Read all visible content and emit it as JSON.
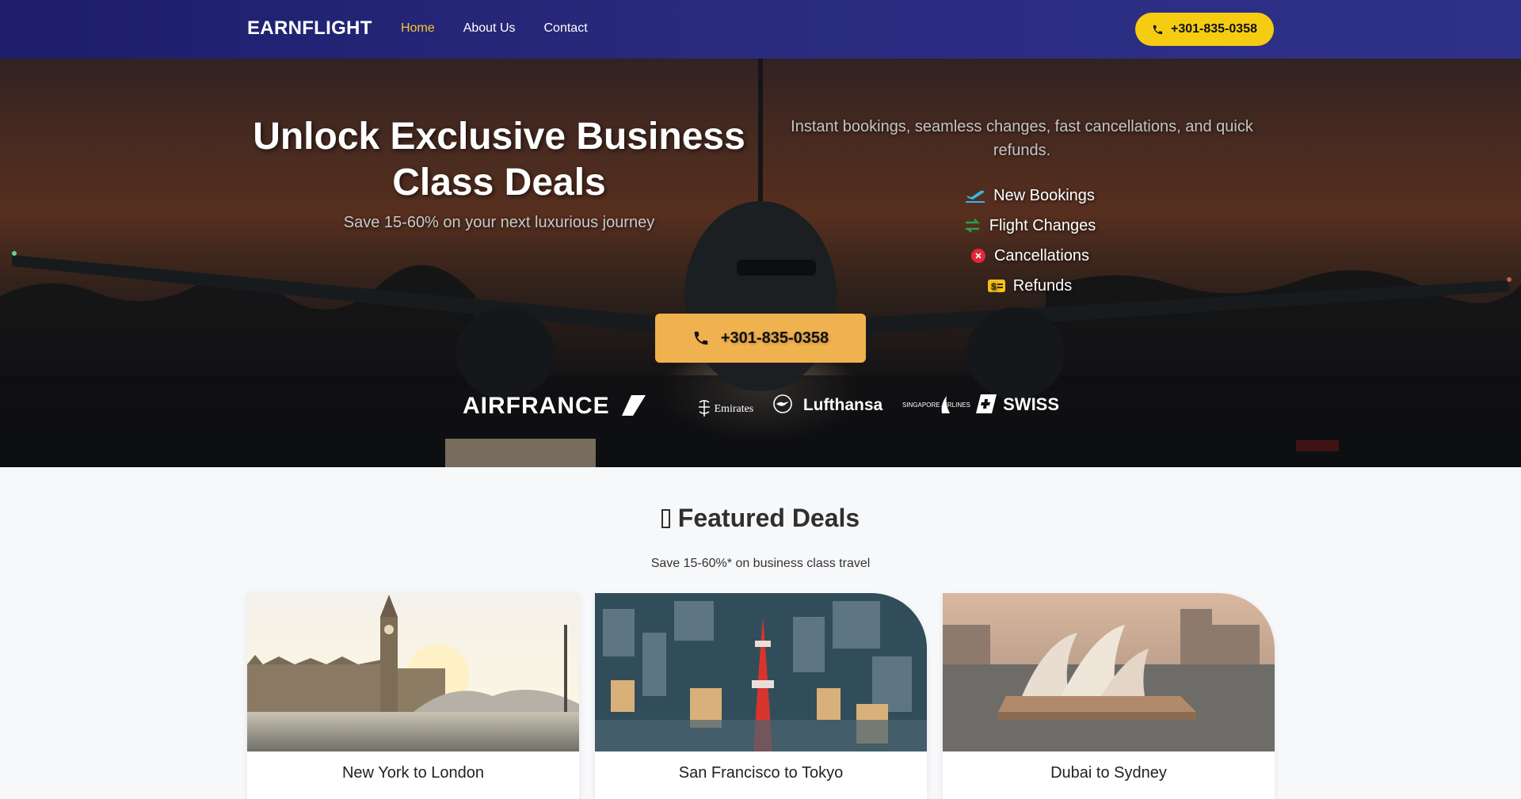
{
  "nav": {
    "brand": "EARNFLIGHT",
    "links": [
      {
        "label": "Home",
        "active": true
      },
      {
        "label": "About Us",
        "active": false
      },
      {
        "label": "Contact",
        "active": false
      }
    ],
    "phone": "+301-835-0358",
    "phone_icon": "phone-icon"
  },
  "hero": {
    "title": "Unlock Exclusive Business Class Deals",
    "subtitle": "Save 15-60% on your next luxurious journey",
    "tagline": "Instant bookings, seamless changes, fast cancellations, and quick refunds.",
    "features": [
      {
        "label": "New Bookings",
        "icon": "plane-departure-icon",
        "color": "#37b6e8"
      },
      {
        "label": "Flight Changes",
        "icon": "exchange-arrows-icon",
        "color": "#2e9e4a"
      },
      {
        "label": "Cancellations",
        "icon": "cancel-circle-icon",
        "color": "#e2263a"
      },
      {
        "label": "Refunds",
        "icon": "money-bill-icon",
        "color": "#f6c21c"
      }
    ],
    "call_phone": "+301-835-0358",
    "airlines": [
      "AIRFRANCE",
      "Emirates",
      "Lufthansa",
      "SINGAPORE AIRLINES",
      "SWISS"
    ]
  },
  "featured": {
    "title": "Featured Deals",
    "title_icon": "missing-glyph-icon",
    "subtitle": "Save 15-60%* on business class travel",
    "deals": [
      {
        "title": "New York to London",
        "image": "london-big-ben-photo"
      },
      {
        "title": "San Francisco to Tokyo",
        "image": "tokyo-tower-photo"
      },
      {
        "title": "Dubai to Sydney",
        "image": "sydney-opera-house-photo"
      }
    ]
  },
  "colors": {
    "nav_bg": "#2a2b7f",
    "accent_yellow": "#f6cc12",
    "cta_orange": "#f0b14f",
    "active_link": "#f6c730"
  }
}
